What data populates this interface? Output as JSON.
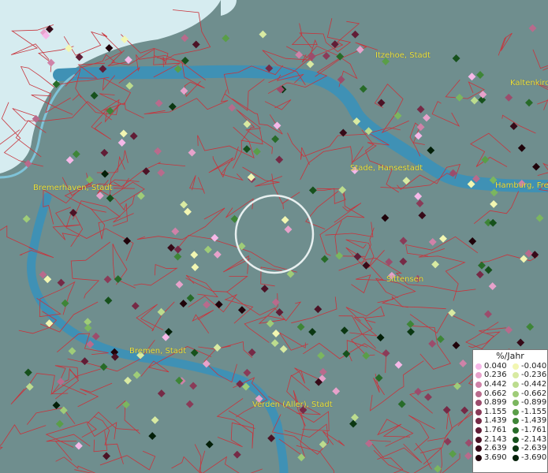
{
  "map": {
    "cities": [
      {
        "name": "Itzehoe, Stadt"
      },
      {
        "name": "Kaltenkirc"
      },
      {
        "name": "Stade, Hansestadt"
      },
      {
        "name": "Hamburg, Fre"
      },
      {
        "name": "Bremerhaven, Stadt"
      },
      {
        "name": "Sittensen"
      },
      {
        "name": "Bremen, Stadt"
      },
      {
        "name": "Verden (Aller), Stadt"
      }
    ]
  },
  "legend": {
    "title": "%/Jahr",
    "positive": [
      {
        "label": "0.040",
        "color": "#f6b8e8"
      },
      {
        "label": "0.236",
        "color": "#e7a2cb"
      },
      {
        "label": "0.442",
        "color": "#cf82a8"
      },
      {
        "label": "0.662",
        "color": "#b86b8c"
      },
      {
        "label": "0.899",
        "color": "#9c4c6c"
      },
      {
        "label": "1.155",
        "color": "#8a3b58"
      },
      {
        "label": "1.439",
        "color": "#762a46"
      },
      {
        "label": "1.761",
        "color": "#611d36"
      },
      {
        "label": "2.143",
        "color": "#4c1326"
      },
      {
        "label": "2.639",
        "color": "#360a18"
      },
      {
        "label": "3.690",
        "color": "#1f030a"
      }
    ],
    "negative": [
      {
        "label": "-0.040",
        "color": "#f2f6b2"
      },
      {
        "label": "-0.236",
        "color": "#d8eaa2"
      },
      {
        "label": "-0.442",
        "color": "#bcdc8e"
      },
      {
        "label": "-0.662",
        "color": "#9fcc78"
      },
      {
        "label": "-0.899",
        "color": "#7bb65f"
      },
      {
        "label": "-1.155",
        "color": "#5a9e48"
      },
      {
        "label": "-1.439",
        "color": "#3e8537"
      },
      {
        "label": "-1.761",
        "color": "#276b28"
      },
      {
        "label": "-2.143",
        "color": "#16511c"
      },
      {
        "label": "-2.639",
        "color": "#0b3712"
      },
      {
        "label": "-3.690",
        "color": "#031f08"
      }
    ]
  }
}
